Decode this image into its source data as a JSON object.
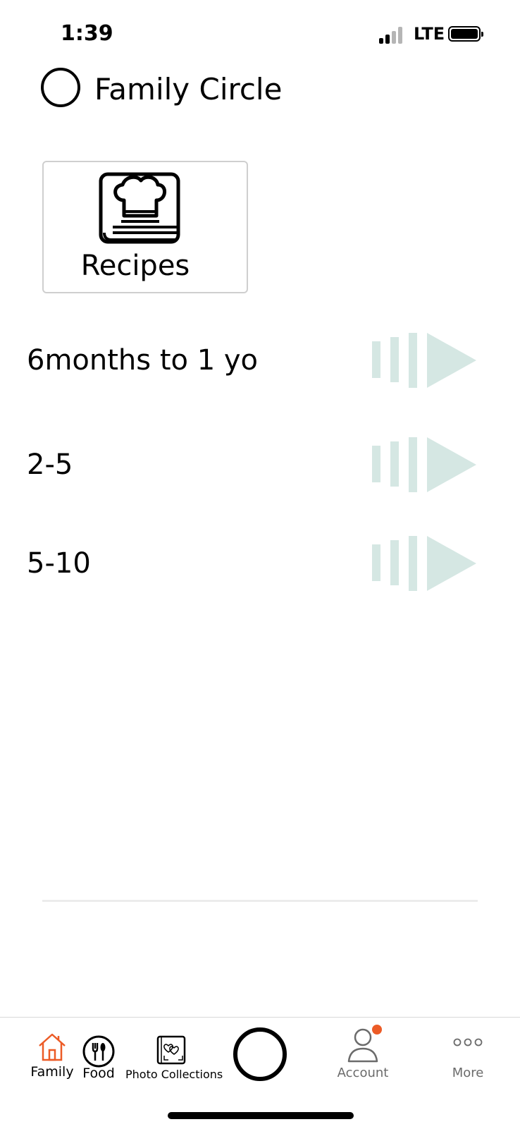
{
  "status_bar": {
    "time": "1:39",
    "network": "LTE"
  },
  "header": {
    "title": "Family Circle"
  },
  "recipes_card": {
    "label": "Recipes",
    "icon": "chef-book-icon"
  },
  "age_groups": [
    {
      "label": "6months to 1 yo"
    },
    {
      "label": "2-5"
    },
    {
      "label": "5-10"
    }
  ],
  "colors": {
    "play_icon": "#d5e7e3",
    "accent": "#ec5b26",
    "muted_text": "#6b6b6b"
  },
  "tab_bar": {
    "family": {
      "label": "Family",
      "icon": "home-icon",
      "active": true
    },
    "food": {
      "label": "Food",
      "icon": "utensils-icon"
    },
    "photos": {
      "label": "Photo Collections",
      "icon": "photo-album-icon"
    },
    "center": {
      "icon": "circle-icon"
    },
    "account": {
      "label": "Account",
      "icon": "user-icon",
      "has_notification": true
    },
    "more": {
      "label": "More",
      "icon": "more-dots-icon"
    }
  }
}
